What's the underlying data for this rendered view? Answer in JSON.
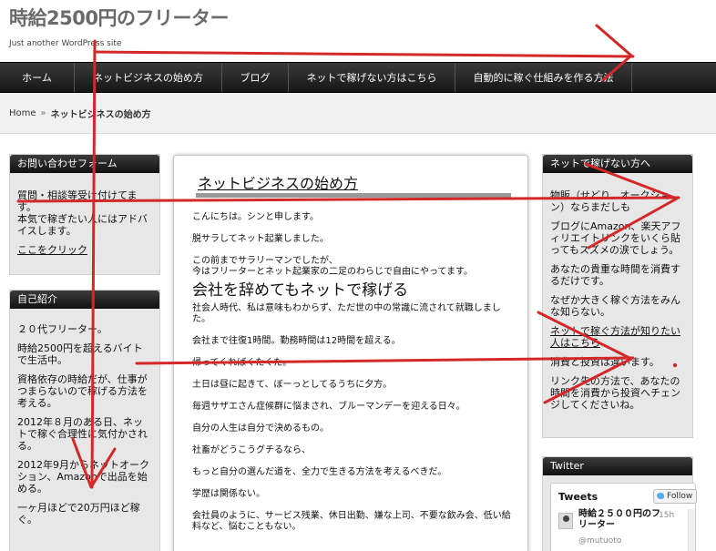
{
  "header": {
    "site_title": "時給2500円のフリーター",
    "tagline": "Just another WordPress site"
  },
  "nav": {
    "items": [
      {
        "label": "ホーム"
      },
      {
        "label": "ネットビジネスの始め方"
      },
      {
        "label": "ブログ"
      },
      {
        "label": "ネットで稼げない方はこちら"
      },
      {
        "label": "自動的に稼ぐ仕組みを作る方法"
      }
    ]
  },
  "breadcrumb": {
    "home": "Home",
    "separator": "»",
    "current": "ネットビジネスの始め方"
  },
  "left_sidebar": {
    "contact": {
      "title": "お問い合わせフォーム",
      "text1": "質問・相談等受け付けてます。",
      "text2": "本気で稼ぎたい人にはアドバイスします。",
      "link": "ここをクリック"
    },
    "profile": {
      "title": "自己紹介",
      "lines": [
        "２０代フリーター。",
        "時給2500円を超えるバイトで生活中。",
        "資格依存の時給だが、仕事がつまらないので稼げる方法を考える。",
        "2012年８月のある日、ネットで稼ぐ合理性に気付かされる。",
        "2012年9月からネットオークション、Amazonで出品を始める。",
        "一ヶ月ほどで20万円ほど稼ぐ。"
      ]
    }
  },
  "article": {
    "title": "ネットビジネスの始め方",
    "p1": "こんにちは。シンと申します。",
    "p2": "脱サラしてネット起業しました。",
    "p3a": "この前までサラリーマンでしたが、",
    "p3b": "今はフリーターとネット起業家の二足のわらじで自由にやってます。",
    "h2": "会社を辞めてもネットで稼げる",
    "p4": "社会人時代、私は意味もわからず、ただ世の中の常識に流されて就職しました。",
    "p5": "会社まで往復1時間。勤務時間は12時間を超える。",
    "p6": "帰ってくればくたくた。",
    "p7": "土日は昼に起きて、ぼーっとしてるうちに夕方。",
    "p8": "毎週サザエさん症候群に悩まされ、ブルーマンデーを迎える日々。",
    "p9": "自分の人生は自分で決めるもの。",
    "p10": "社畜がどうこうグチるなら、",
    "p11": "もっと自分の選んだ道を、全力で生きる方法を考えるべきだ。",
    "p12": "学歴は関係ない。",
    "p13": "会社員のように、サービス残業、休日出勤、嫌な上司、不要な飲み会、低い給料など、悩むこともない。"
  },
  "right_sidebar": {
    "netwidget": {
      "title": "ネットで稼げない方へ",
      "p1": "物販（せどり、オークション）ならまだしも",
      "p2": "ブログにAmazon、楽天アフィリエイトリンクをいくら貼ってもスズメの涙でしょう。",
      "p3": "あなたの貴重な時間を消費するだけです。",
      "p4": "なぜか大きく稼ぐ方法をみんな知らない。",
      "link": "ネットで稼ぐ方法が知りたい人はこちら",
      "p5": "消費と投資は違います。",
      "p6": "リンク先の方法で、あなたの時間を消費から投資へチェンジしてくださいね。"
    },
    "twitter": {
      "title": "Twitter",
      "tweets_label": "Tweets",
      "follow_label": "Follow",
      "name": "時給２５００円のフリーター",
      "handle": "@mutuoto",
      "time": "15h"
    }
  },
  "annotation_color": "#d42828"
}
